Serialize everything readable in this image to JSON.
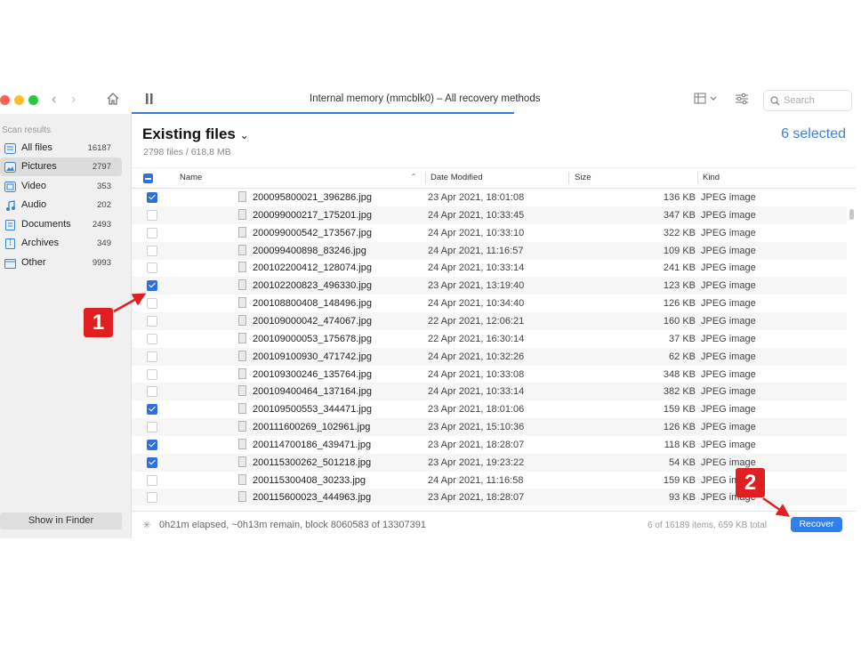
{
  "window": {
    "title": "Internal memory (mmcblk0) – All recovery methods",
    "search_placeholder": "Search"
  },
  "sidebar": {
    "heading": "Scan results",
    "items": [
      {
        "label": "All files",
        "count": "16187",
        "icon": "all-files-icon"
      },
      {
        "label": "Pictures",
        "count": "2797",
        "icon": "pictures-icon"
      },
      {
        "label": "Video",
        "count": "353",
        "icon": "video-icon"
      },
      {
        "label": "Audio",
        "count": "202",
        "icon": "audio-icon"
      },
      {
        "label": "Documents",
        "count": "2493",
        "icon": "documents-icon"
      },
      {
        "label": "Archives",
        "count": "349",
        "icon": "archives-icon"
      },
      {
        "label": "Other",
        "count": "9993",
        "icon": "other-icon"
      }
    ],
    "show_in_finder": "Show in Finder"
  },
  "main": {
    "heading": "Existing files",
    "subheading": "2798 files / 618,8 MB",
    "selected": "6 selected",
    "columns": {
      "name": "Name",
      "date": "Date Modified",
      "size": "Size",
      "kind": "Kind"
    }
  },
  "files": [
    {
      "name": "200095800021_396286.jpg",
      "date": "23 Apr 2021, 18:01:08",
      "size": "136 KB",
      "kind": "JPEG image",
      "checked": true
    },
    {
      "name": "200099000217_175201.jpg",
      "date": "24 Apr 2021, 10:33:45",
      "size": "347 KB",
      "kind": "JPEG image",
      "checked": false
    },
    {
      "name": "200099000542_173567.jpg",
      "date": "24 Apr 2021, 10:33:10",
      "size": "322 KB",
      "kind": "JPEG image",
      "checked": false
    },
    {
      "name": "200099400898_83246.jpg",
      "date": "24 Apr 2021, 11:16:57",
      "size": "109 KB",
      "kind": "JPEG image",
      "checked": false
    },
    {
      "name": "200102200412_128074.jpg",
      "date": "24 Apr 2021, 10:33:14",
      "size": "241 KB",
      "kind": "JPEG image",
      "checked": false
    },
    {
      "name": "200102200823_496330.jpg",
      "date": "23 Apr 2021, 13:19:40",
      "size": "123 KB",
      "kind": "JPEG image",
      "checked": true
    },
    {
      "name": "200108800408_148496.jpg",
      "date": "24 Apr 2021, 10:34:40",
      "size": "126 KB",
      "kind": "JPEG image",
      "checked": false
    },
    {
      "name": "200109000042_474067.jpg",
      "date": "22 Apr 2021, 12:06:21",
      "size": "160 KB",
      "kind": "JPEG image",
      "checked": false
    },
    {
      "name": "200109000053_175678.jpg",
      "date": "22 Apr 2021, 16:30:14",
      "size": "37 KB",
      "kind": "JPEG image",
      "checked": false
    },
    {
      "name": "200109100930_471742.jpg",
      "date": "24 Apr 2021, 10:32:26",
      "size": "62 KB",
      "kind": "JPEG image",
      "checked": false
    },
    {
      "name": "200109300246_135764.jpg",
      "date": "24 Apr 2021, 10:33:08",
      "size": "348 KB",
      "kind": "JPEG image",
      "checked": false
    },
    {
      "name": "200109400464_137164.jpg",
      "date": "24 Apr 2021, 10:33:14",
      "size": "382 KB",
      "kind": "JPEG image",
      "checked": false
    },
    {
      "name": "200109500553_344471.jpg",
      "date": "23 Apr 2021, 18:01:06",
      "size": "159 KB",
      "kind": "JPEG image",
      "checked": true
    },
    {
      "name": "200111600269_102961.jpg",
      "date": "23 Apr 2021, 15:10:36",
      "size": "126 KB",
      "kind": "JPEG image",
      "checked": false
    },
    {
      "name": "200114700186_439471.jpg",
      "date": "23 Apr 2021, 18:28:07",
      "size": "118 KB",
      "kind": "JPEG image",
      "checked": true
    },
    {
      "name": "200115300262_501218.jpg",
      "date": "23 Apr 2021, 19:23:22",
      "size": "54 KB",
      "kind": "JPEG image",
      "checked": true
    },
    {
      "name": "200115300408_30233.jpg",
      "date": "24 Apr 2021, 11:16:58",
      "size": "159 KB",
      "kind": "JPEG image",
      "checked": false
    },
    {
      "name": "200115600023_444963.jpg",
      "date": "23 Apr 2021, 18:28:07",
      "size": "93 KB",
      "kind": "JPEG image",
      "checked": false
    }
  ],
  "status": {
    "elapsed": "0h21m elapsed, ~0h13m remain, block 8060583 of 13307391",
    "totals": "6 of 16189 items, 659 KB total",
    "recover": "Recover"
  },
  "annotations": {
    "badge1": "1",
    "badge2": "2",
    "color": "#e02020"
  },
  "colors": {
    "accent": "#2f6fe0",
    "selected_text": "#3b82d6"
  }
}
